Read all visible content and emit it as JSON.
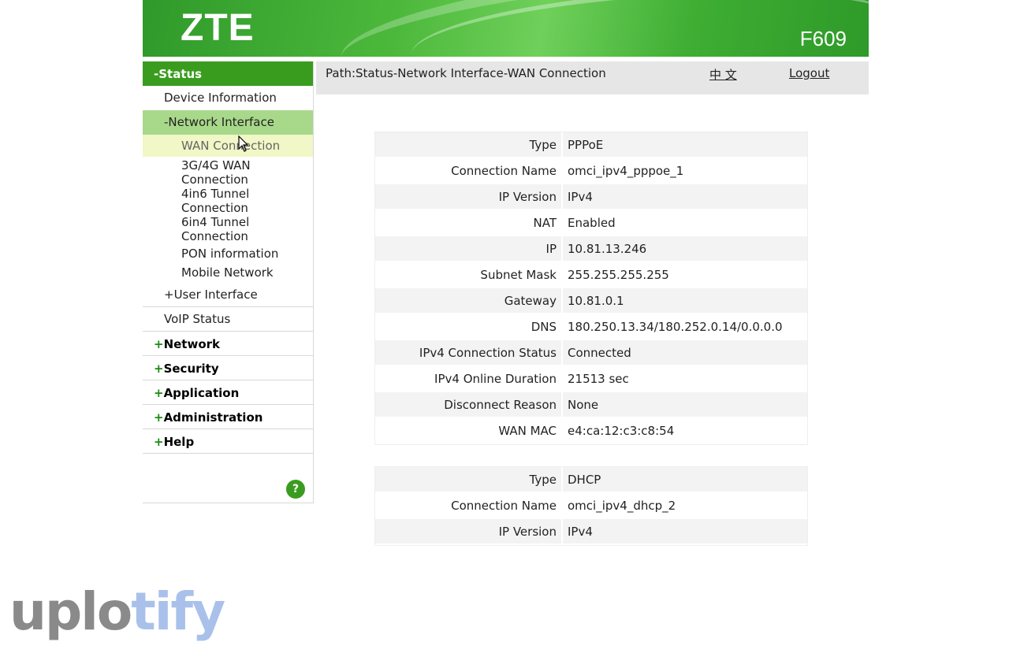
{
  "header": {
    "brand": "ZTE",
    "model": "F609"
  },
  "path_bar": {
    "path": "Path:Status-Network Interface-WAN Connection",
    "language": "中 文",
    "logout": "Logout"
  },
  "sidebar": {
    "status": "-Status",
    "device_information": "Device Information",
    "network_interface": "-Network Interface",
    "sub_items": [
      "WAN Connection",
      "3G/4G WAN Connection",
      "4in6 Tunnel Connection",
      "6in4 Tunnel Connection",
      "PON information",
      "Mobile Network"
    ],
    "user_interface": "+User Interface",
    "voip_status": "VoIP Status",
    "network": "Network",
    "security": "Security",
    "application": "Application",
    "administration": "Administration",
    "help": "Help",
    "plus": "+",
    "help_icon": "?"
  },
  "wan1": [
    {
      "k": "Type",
      "v": "PPPoE"
    },
    {
      "k": "Connection Name",
      "v": "omci_ipv4_pppoe_1"
    },
    {
      "k": "IP Version",
      "v": "IPv4"
    },
    {
      "k": "NAT",
      "v": "Enabled"
    },
    {
      "k": "IP",
      "v": "10.81.13.246"
    },
    {
      "k": "Subnet Mask",
      "v": "255.255.255.255"
    },
    {
      "k": "Gateway",
      "v": "10.81.0.1"
    },
    {
      "k": "DNS",
      "v": "180.250.13.34/180.252.0.14/0.0.0.0"
    },
    {
      "k": "IPv4 Connection Status",
      "v": "Connected"
    },
    {
      "k": "IPv4 Online Duration",
      "v": "21513 sec"
    },
    {
      "k": "Disconnect Reason",
      "v": "None"
    },
    {
      "k": "WAN MAC",
      "v": "e4:ca:12:c3:c8:54"
    }
  ],
  "wan2": [
    {
      "k": "Type",
      "v": "DHCP"
    },
    {
      "k": "Connection Name",
      "v": "omci_ipv4_dhcp_2"
    },
    {
      "k": "IP Version",
      "v": "IPv4"
    }
  ],
  "watermark": {
    "part1": "uplo",
    "part2": "tify"
  },
  "colors": {
    "brand_green": "#3a9c1f",
    "active_sub": "#a8d98a",
    "hover_row": "#f1f7c6"
  }
}
